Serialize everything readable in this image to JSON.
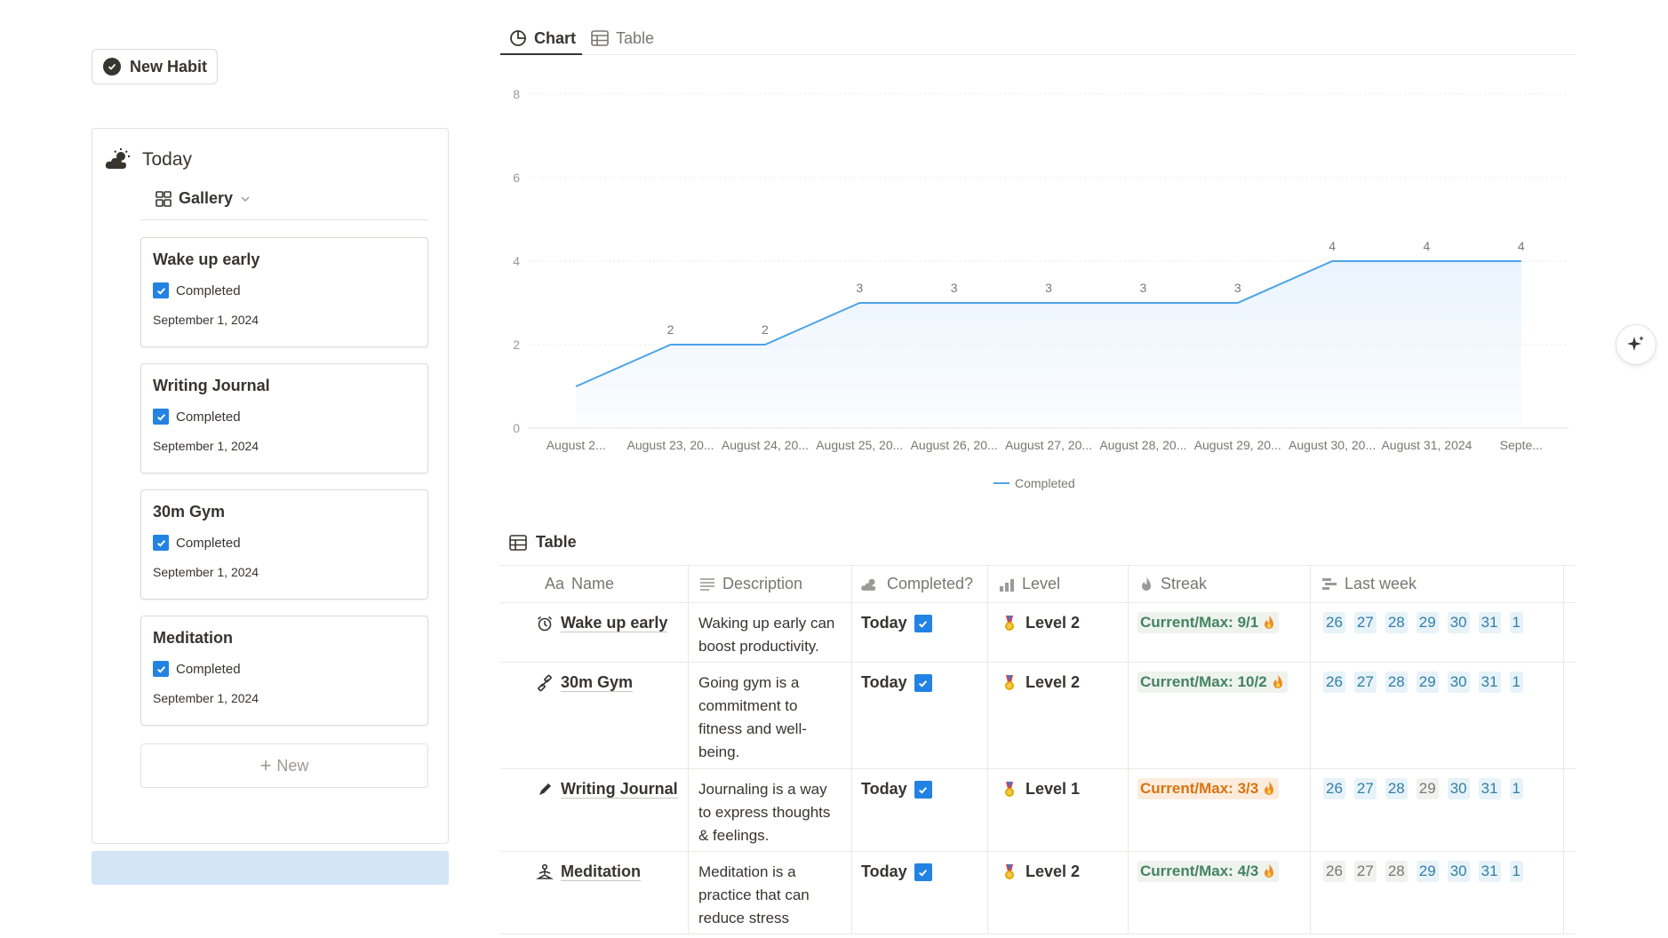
{
  "left": {
    "new_habit_label": "New Habit",
    "today_title": "Today",
    "gallery_label": "Gallery",
    "cards": [
      {
        "title": "Wake up early",
        "check_label": "Completed",
        "date": "September 1, 2024"
      },
      {
        "title": "Writing Journal",
        "check_label": "Completed",
        "date": "September 1, 2024"
      },
      {
        "title": "30m Gym",
        "check_label": "Completed",
        "date": "September 1, 2024"
      },
      {
        "title": "Meditation",
        "check_label": "Completed",
        "date": "September 1, 2024"
      }
    ],
    "new_label": "New"
  },
  "tabs": {
    "chart": "Chart",
    "table": "Table"
  },
  "chart_data": {
    "type": "area",
    "categories": [
      "August 2...",
      "August 23, 20...",
      "August 24, 20...",
      "August 25, 20...",
      "August 26, 20...",
      "August 27, 20...",
      "August 28, 20...",
      "August 29, 20...",
      "August 30, 20...",
      "August 31, 2024",
      "Septe..."
    ],
    "series": [
      {
        "name": "Completed",
        "values": [
          1,
          2,
          2,
          3,
          3,
          3,
          3,
          3,
          4,
          4,
          4
        ]
      }
    ],
    "data_labels": [
      "",
      "2",
      "2",
      "3",
      "3",
      "3",
      "3",
      "3",
      "4",
      "4",
      "4"
    ],
    "ylim": [
      0,
      8
    ],
    "yticks": [
      "0",
      "2",
      "4",
      "6",
      "8"
    ],
    "grid": true,
    "legend": "bottom-center",
    "line_color": "#4da3e6",
    "fill_color": "#eaf4fd"
  },
  "table": {
    "label": "Table",
    "headers": {
      "name": "Name",
      "desc": "Description",
      "completed": "Completed?",
      "level": "Level",
      "streak": "Streak",
      "last_week": "Last week"
    },
    "name_prefix": "Aa",
    "rows": [
      {
        "name": "Wake up early",
        "icon": "alarm-clock-icon",
        "desc": "Waking up early can boost productivity.",
        "completed": "Today",
        "level": "Level 2",
        "streak": "Current/Max: 9/1",
        "streak_color": "green",
        "days": [
          {
            "d": "26",
            "on": true
          },
          {
            "d": "27",
            "on": true
          },
          {
            "d": "28",
            "on": true
          },
          {
            "d": "29",
            "on": true
          },
          {
            "d": "30",
            "on": true
          },
          {
            "d": "31",
            "on": true
          },
          {
            "d": "1",
            "on": true
          }
        ]
      },
      {
        "name": "30m Gym",
        "icon": "dumbbell-icon",
        "desc": "Going gym is a commitment to fitness and well-being.",
        "completed": "Today",
        "level": "Level 2",
        "streak": "Current/Max: 10/2",
        "streak_color": "green",
        "days": [
          {
            "d": "26",
            "on": true
          },
          {
            "d": "27",
            "on": true
          },
          {
            "d": "28",
            "on": true
          },
          {
            "d": "29",
            "on": true
          },
          {
            "d": "30",
            "on": true
          },
          {
            "d": "31",
            "on": true
          },
          {
            "d": "1",
            "on": true
          }
        ]
      },
      {
        "name": "Writing Journal",
        "icon": "pen-icon",
        "desc": "Journaling is a way to express thoughts & feelings.",
        "completed": "Today",
        "level": "Level 1",
        "streak": "Current/Max: 3/3",
        "streak_color": "orange",
        "days": [
          {
            "d": "26",
            "on": true
          },
          {
            "d": "27",
            "on": true
          },
          {
            "d": "28",
            "on": true
          },
          {
            "d": "29",
            "on": false
          },
          {
            "d": "30",
            "on": true
          },
          {
            "d": "31",
            "on": true
          },
          {
            "d": "1",
            "on": true
          }
        ]
      },
      {
        "name": "Meditation",
        "icon": "meditation-icon",
        "desc": "Meditation is a practice that can reduce stress",
        "completed": "Today",
        "level": "Level 2",
        "streak": "Current/Max: 4/3",
        "streak_color": "green",
        "days": [
          {
            "d": "26",
            "on": false
          },
          {
            "d": "27",
            "on": false
          },
          {
            "d": "28",
            "on": false
          },
          {
            "d": "29",
            "on": true
          },
          {
            "d": "30",
            "on": true
          },
          {
            "d": "31",
            "on": true
          },
          {
            "d": "1",
            "on": true
          }
        ]
      }
    ]
  }
}
